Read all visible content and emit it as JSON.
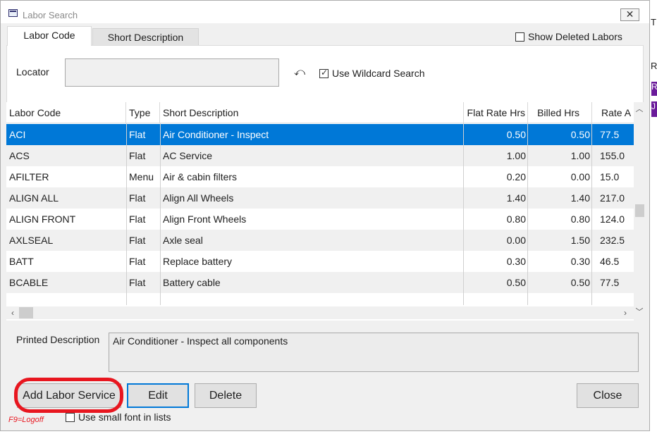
{
  "window": {
    "title": "Labor Search",
    "close_label": "✕"
  },
  "background": {
    "t": "T",
    "r": "R",
    "p1": "R",
    "p2": "J"
  },
  "tabs": [
    {
      "label": "Labor Code",
      "active": true
    },
    {
      "label": "Short Description",
      "active": false
    }
  ],
  "show_deleted": {
    "label": "Show Deleted Labors",
    "checked": false
  },
  "locator": {
    "label": "Locator",
    "value": "",
    "undo_icon": "undo-icon"
  },
  "wildcard": {
    "label": "Use Wildcard Search",
    "checked": true
  },
  "grid": {
    "columns": [
      "Labor Code",
      "Type",
      "Short Description",
      "Flat Rate Hrs",
      "Billed Hrs",
      "Rate A"
    ],
    "rows": [
      {
        "code": "ACI",
        "type": "Flat",
        "desc": "Air Conditioner - Inspect",
        "flat": "0.50",
        "billed": "0.50",
        "rate": "77.5"
      },
      {
        "code": "ACS",
        "type": "Flat",
        "desc": "AC Service",
        "flat": "1.00",
        "billed": "1.00",
        "rate": "155.0"
      },
      {
        "code": "AFILTER",
        "type": "Menu",
        "desc": "Air & cabin filters",
        "flat": "0.20",
        "billed": "0.00",
        "rate": "15.0"
      },
      {
        "code": "ALIGN ALL",
        "type": "Flat",
        "desc": "Align All Wheels",
        "flat": "1.40",
        "billed": "1.40",
        "rate": "217.0"
      },
      {
        "code": "ALIGN FRONT",
        "type": "Flat",
        "desc": "Align Front Wheels",
        "flat": "0.80",
        "billed": "0.80",
        "rate": "124.0"
      },
      {
        "code": "AXLSEAL",
        "type": "Flat",
        "desc": "Axle seal",
        "flat": "0.00",
        "billed": "1.50",
        "rate": "232.5"
      },
      {
        "code": "BATT",
        "type": "Flat",
        "desc": "Replace battery",
        "flat": "0.30",
        "billed": "0.30",
        "rate": "46.5"
      },
      {
        "code": "BCABLE",
        "type": "Flat",
        "desc": "Battery cable",
        "flat": "0.50",
        "billed": "0.50",
        "rate": "77.5"
      }
    ],
    "selected_index": 0
  },
  "printed": {
    "label": "Printed Description",
    "value": "Air Conditioner - Inspect all components"
  },
  "buttons": {
    "add": "Add Labor Service",
    "edit": "Edit",
    "delete": "Delete",
    "close": "Close"
  },
  "footer": {
    "f9": "F9=Logoff",
    "small_font_label": "Use small font in lists",
    "small_font_checked": false
  }
}
